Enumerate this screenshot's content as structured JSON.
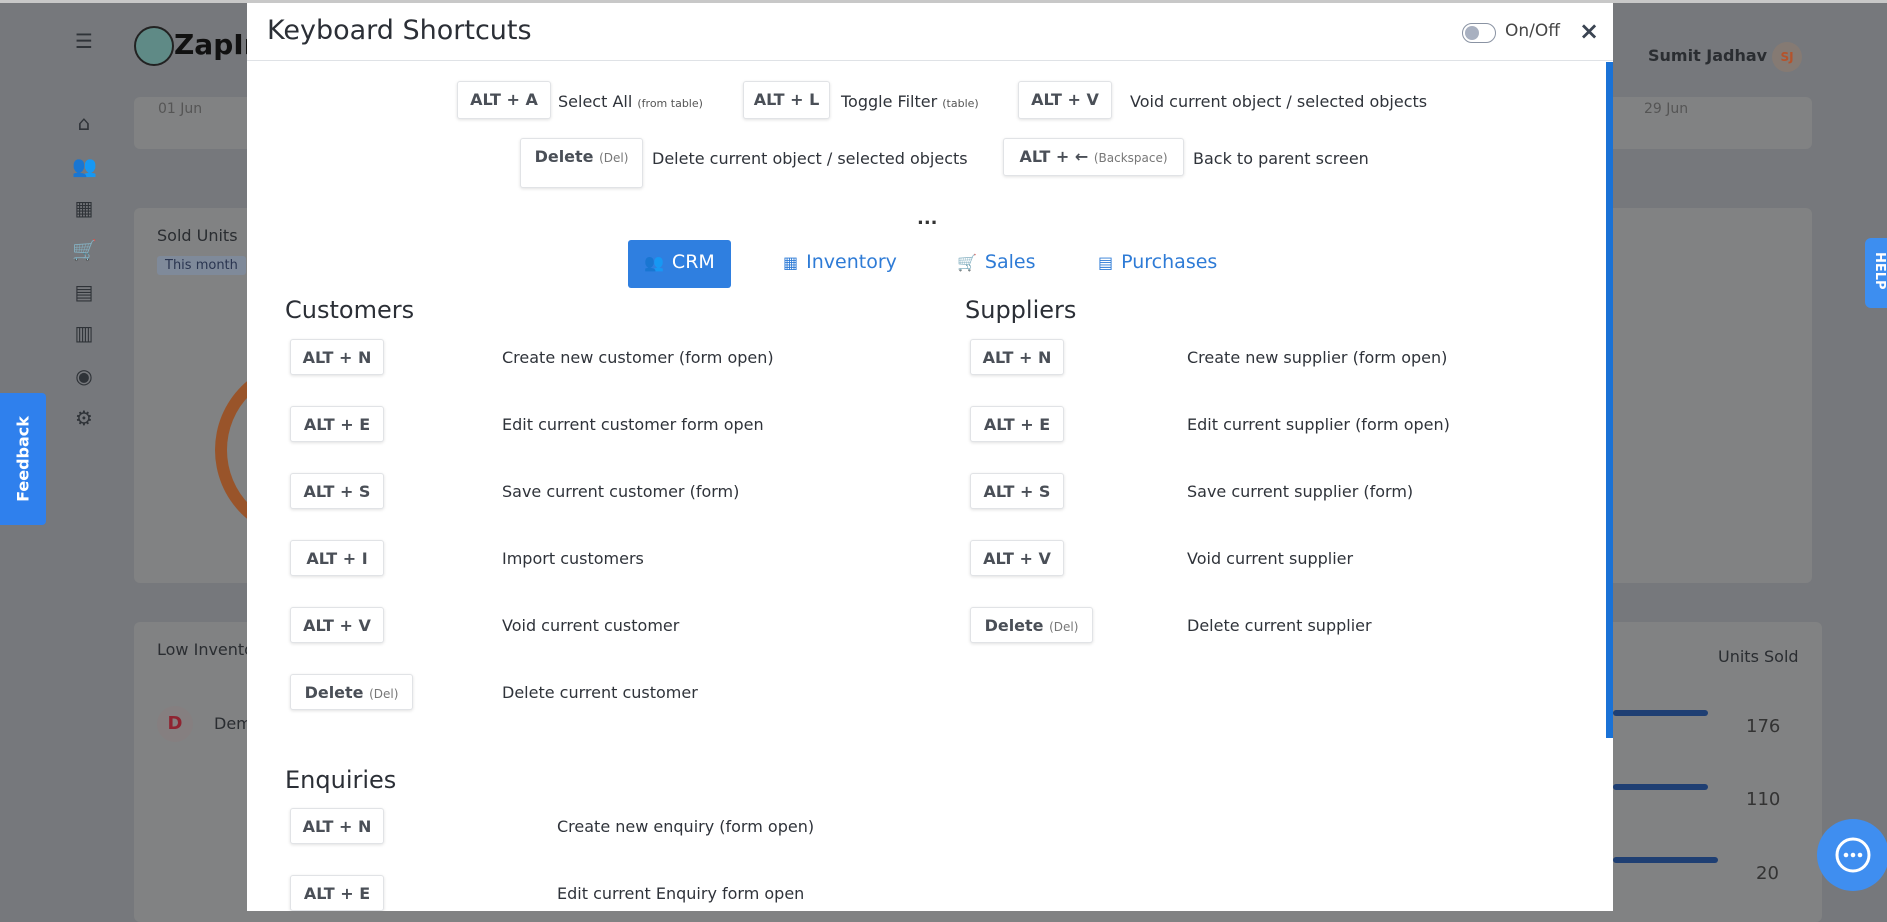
{
  "background": {
    "brand": "ZapInv",
    "user_name": "Sumit Jadhav",
    "user_initials": "SJ",
    "date_start": "01 Jun",
    "date_end": "29 Jun",
    "sold_units_title": "Sold Units",
    "sold_units_filter": "This month",
    "low_inventory_title": "Low Invento",
    "units_sold_header": "Units Sold",
    "rows": [
      {
        "avatar": "D",
        "name": "Dem",
        "units": "176"
      },
      {
        "units": "110"
      },
      {
        "units": "20"
      }
    ],
    "feedback_label": "Feedback",
    "help_label": "HELP",
    "sidebar_icons": [
      "menu-icon",
      "home-icon",
      "users-icon",
      "inventory-icon",
      "cart-icon",
      "cash-register-icon",
      "chart-icon",
      "account-icon",
      "gear-icon"
    ]
  },
  "modal": {
    "title": "Keyboard Shortcuts",
    "toggle_label": "On/Off",
    "toggle_on": false,
    "close": "×",
    "more": "...",
    "global": [
      {
        "key": "ALT + A",
        "desc": "Select All",
        "note": "(from table)"
      },
      {
        "key": "ALT + L",
        "desc": "Toggle Filter",
        "note": "(table)"
      },
      {
        "key": "ALT + V",
        "desc": "Void current object / selected objects",
        "note": ""
      },
      {
        "key": "Delete",
        "keynote": "(Del)",
        "desc": "Delete current object / selected objects",
        "note": ""
      },
      {
        "key": "ALT + ←",
        "keynote": "(Backspace)",
        "desc": "Back to parent screen",
        "note": ""
      }
    ],
    "tabs": [
      {
        "label": "CRM",
        "icon": "users-icon",
        "active": true
      },
      {
        "label": "Inventory",
        "icon": "inventory-icon",
        "active": false
      },
      {
        "label": "Sales",
        "icon": "cart-icon",
        "active": false
      },
      {
        "label": "Purchases",
        "icon": "cash-register-icon",
        "active": false
      }
    ],
    "customers": {
      "title": "Customers",
      "items": [
        {
          "key": "ALT + N",
          "desc": "Create new customer (form open)"
        },
        {
          "key": "ALT + E",
          "desc": "Edit current customer form open"
        },
        {
          "key": "ALT + S",
          "desc": "Save current customer (form)"
        },
        {
          "key": "ALT + I",
          "desc": "Import customers"
        },
        {
          "key": "ALT + V",
          "desc": "Void current customer"
        },
        {
          "key": "Delete",
          "keynote": "(Del)",
          "desc": "Delete current customer"
        }
      ]
    },
    "suppliers": {
      "title": "Suppliers",
      "items": [
        {
          "key": "ALT + N",
          "desc": "Create new supplier (form open)"
        },
        {
          "key": "ALT + E",
          "desc": "Edit current supplier (form open)"
        },
        {
          "key": "ALT + S",
          "desc": "Save current supplier (form)"
        },
        {
          "key": "ALT + V",
          "desc": "Void current supplier"
        },
        {
          "key": "Delete",
          "keynote": "(Del)",
          "desc": "Delete current supplier"
        }
      ]
    },
    "enquiries": {
      "title": "Enquiries",
      "items": [
        {
          "key": "ALT + N",
          "desc": "Create new enquiry (form open)"
        },
        {
          "key": "ALT + E",
          "desc": "Edit current Enquiry form open"
        }
      ]
    }
  },
  "colors": {
    "accent": "#2f7fe0",
    "overlay": "#76787c",
    "feedback": "#2f80ed"
  }
}
